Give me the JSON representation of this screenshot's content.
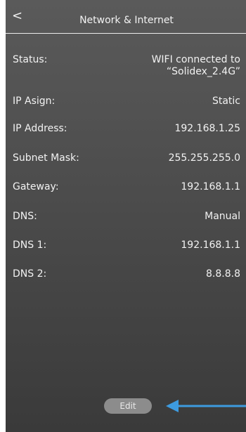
{
  "header": {
    "back_label": "<",
    "title": "Network & Internet"
  },
  "rows": [
    {
      "label": "Status:",
      "value_line1": "WIFI connected to",
      "value_line2": "“Solidex_2.4G”"
    },
    {
      "label": "IP Asign:",
      "value": "Static"
    },
    {
      "label": "IP Address:",
      "value": "192.168.1.25"
    },
    {
      "label": "Subnet Mask:",
      "value": "255.255.255.0"
    },
    {
      "label": "Gateway:",
      "value": "192.168.1.1"
    },
    {
      "label": "DNS:",
      "value": "Manual"
    },
    {
      "label": "DNS 1:",
      "value": "192.168.1.1"
    },
    {
      "label": "DNS 2:",
      "value": "8.8.8.8"
    }
  ],
  "footer": {
    "edit_label": "Edit"
  },
  "colors": {
    "accent_arrow": "#3d9be0",
    "button_bg": "#8c8c8c"
  },
  "icons": {
    "back": "chevron-left-icon",
    "pointer": "arrow-left-icon"
  }
}
